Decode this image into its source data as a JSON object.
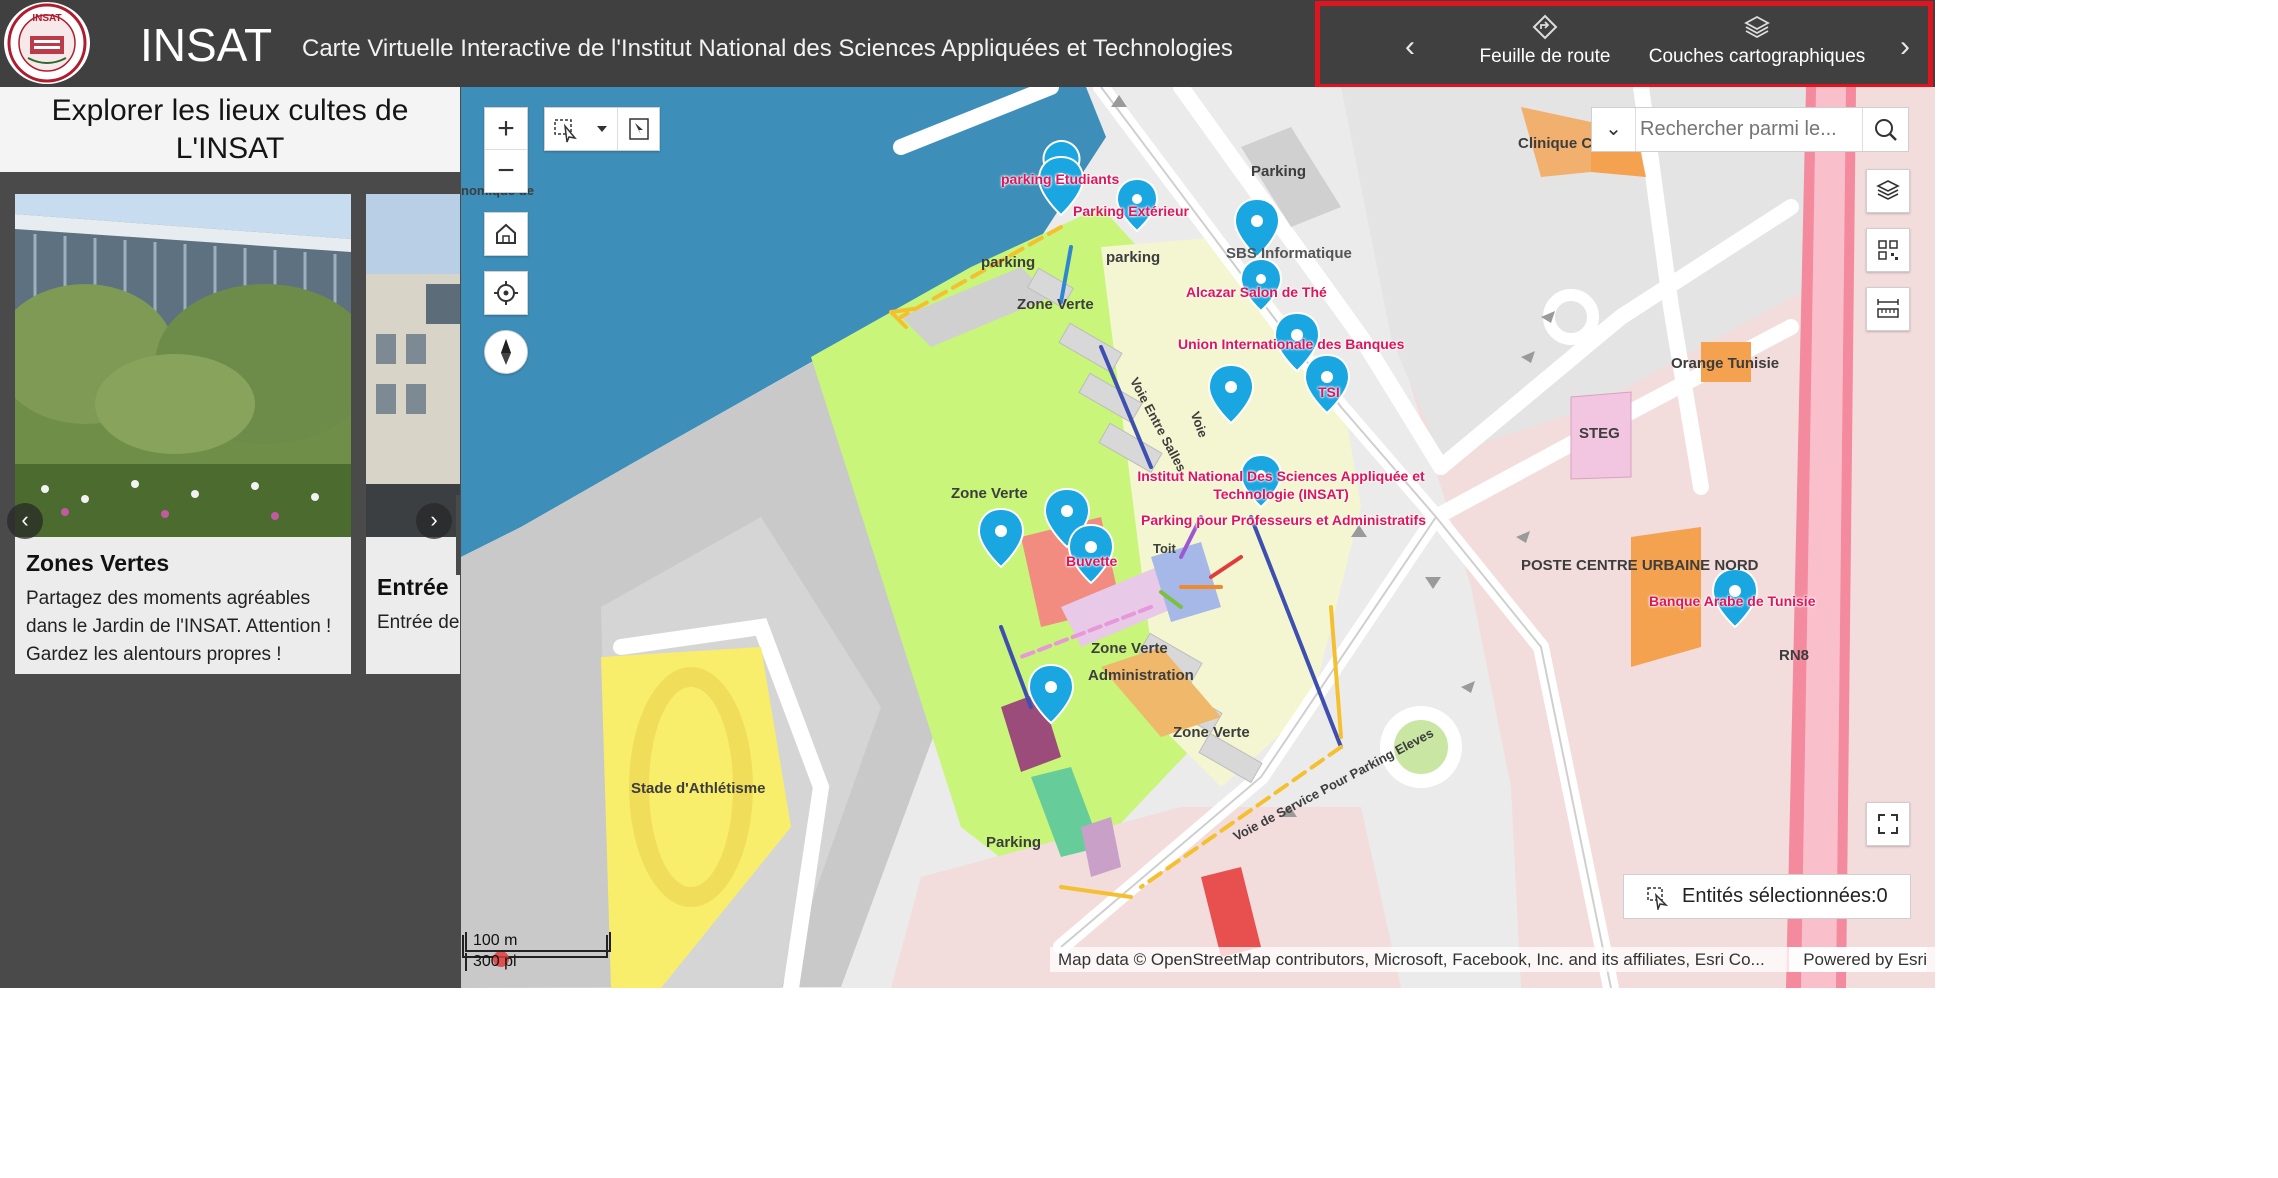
{
  "header": {
    "logo_text": "INSAT",
    "title": "INSAT",
    "subtitle": "Carte Virtuelle Interactive de l'Institut National des Sciences Appliquées et Technologies",
    "nav": {
      "roadmap_label": "Feuille de route",
      "layers_label": "Couches cartographiques",
      "prev_icon": "chevron-left-icon",
      "next_icon": "chevron-right-icon"
    }
  },
  "sidebar": {
    "title": "Explorer les lieux cultes de L'INSAT",
    "cards": [
      {
        "title": "Zones Vertes",
        "text": "Partagez des moments agréables dans le Jardin de l'INSAT. Attention ! Gardez les alentours propres !"
      },
      {
        "title": "Entrée",
        "text": "Entrée de ... dire bonjo..."
      }
    ]
  },
  "map": {
    "search": {
      "placeholder": "Rechercher parmi le..."
    },
    "selected": {
      "label": "Entités sélectionnées:0"
    },
    "attribution": "Map data © OpenStreetMap contributors, Microsoft, Facebook, Inc. and its affiliates, Esri Co...",
    "powered_by": "Powered by Esri",
    "scale": {
      "metric": "100 m",
      "imperial": "300 pi"
    },
    "poi_labels": {
      "parking_etudiants": "parking Etudiants",
      "parking_exterieur": "Parking Extérieur",
      "alcazar": "Alcazar Salon de Thé",
      "union_banques": "Union Internationale des Banques",
      "tsi": "TSI",
      "insat": "Institut National Des Sciences Appliquée et Technologie (INSAT)",
      "parking_profs": "Parking pour Professeurs et Administratifs",
      "buvette": "Buvette",
      "banque_arabe": "Banque Arabe de Tunisie"
    },
    "area_labels": {
      "parking_top": "Parking",
      "parking_left": "parking",
      "parking_mid": "parking",
      "parking_bottom": "Parking",
      "sbs": "SBS Informatique",
      "zone_verte_1": "Zone Verte",
      "zone_verte_2": "Zone Verte",
      "zone_verte_3": "Zone Verte",
      "zone_verte_4": "Zone Verte",
      "administration": "Administration",
      "stade": "Stade d'Athlétisme",
      "clinique": "Clinique C",
      "orange": "Orange Tunisie",
      "steg": "STEG",
      "poste": "POSTE CENTRE URBAINE NORD",
      "rn8": "RN8",
      "toit": "Toit",
      "voie": "Voie",
      "voie_entre_salles": "Voie Entre Salles",
      "voie_service": "Voie de Service Pour Parking Eleves",
      "econ": "nomique de"
    },
    "colors": {
      "water": "#3d8eb9",
      "green": "#c8f57a",
      "poi_pin": "#1aa6e0",
      "poi_text": "#e0145a",
      "highlight": "#e0141e"
    }
  }
}
